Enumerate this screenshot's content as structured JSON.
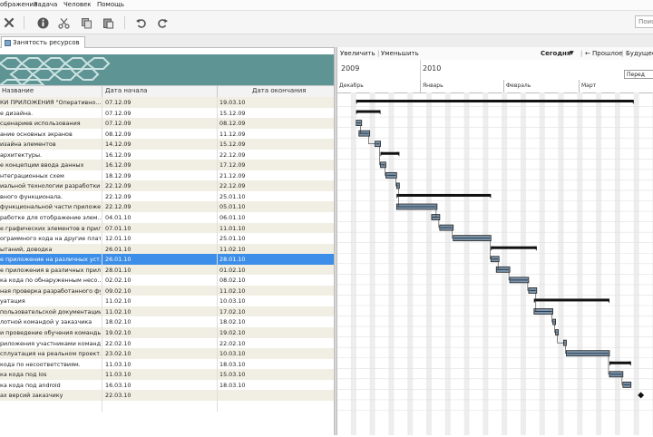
{
  "menu": [
    "ображение",
    "Задача",
    "Человек",
    "Помощь"
  ],
  "search": {
    "placeholder": "Поиск"
  },
  "tab": {
    "label": "Занятость ресурсов"
  },
  "columns": {
    "name": "Название",
    "start": "Дата начала",
    "end": "Дата окончания"
  },
  "rows": [
    {
      "name": "КИ ПРИЛОЖЕНИЯ \"Оперативно...",
      "start": "07.12.09",
      "end": "19.03.10",
      "kind": "summary"
    },
    {
      "name": "е дизайна.",
      "start": "07.12.09",
      "end": "15.12.09",
      "kind": "summary"
    },
    {
      "name": "сценариев использования",
      "start": "07.12.09",
      "end": "08.12.09",
      "kind": "task"
    },
    {
      "name": "ание основных экранов",
      "start": "08.12.09",
      "end": "11.12.09",
      "kind": "task"
    },
    {
      "name": "изайна элементов",
      "start": "14.12.09",
      "end": "15.12.09",
      "kind": "task"
    },
    {
      "name": "архитектуры.",
      "start": "16.12.09",
      "end": "22.12.09",
      "kind": "summary"
    },
    {
      "name": "е концепции ввода данных",
      "start": "16.12.09",
      "end": "17.12.09",
      "kind": "task"
    },
    {
      "name": "нтеграционных схем",
      "start": "18.12.09",
      "end": "21.12.09",
      "kind": "task"
    },
    {
      "name": "иальной технологии разработки",
      "start": "22.12.09",
      "end": "22.12.09",
      "kind": "task"
    },
    {
      "name": "вного функционала.",
      "start": "22.12.09",
      "end": "25.01.10",
      "kind": "summary"
    },
    {
      "name": "функциональной части приложе...",
      "start": "22.12.09",
      "end": "05.01.10",
      "kind": "task"
    },
    {
      "name": "работке для отображение элем...",
      "start": "04.01.10",
      "end": "06.01.10",
      "kind": "task"
    },
    {
      "name": "е графических элементов в прил...",
      "start": "07.01.10",
      "end": "11.01.10",
      "kind": "task"
    },
    {
      "name": "ограммного кода на другие плат...",
      "start": "12.01.10",
      "end": "25.01.10",
      "kind": "task"
    },
    {
      "name": "ытаний, доводка",
      "start": "26.01.10",
      "end": "11.02.10",
      "kind": "summary"
    },
    {
      "name": "е приложение на различных уст...",
      "start": "26.01.10",
      "end": "28.01.10",
      "kind": "task",
      "selected": true
    },
    {
      "name": "е приложения в различных  прил...",
      "start": "28.01.10",
      "end": "01.02.10",
      "kind": "task"
    },
    {
      "name": "ка кода по обнаруженным несо...",
      "start": "02.02.10",
      "end": "08.02.10",
      "kind": "task"
    },
    {
      "name": "ная проверка разработанного фу...",
      "start": "09.02.10",
      "end": "11.02.10",
      "kind": "task"
    },
    {
      "name": "уатация",
      "start": "11.02.10",
      "end": "10.03.10",
      "kind": "summary"
    },
    {
      "name": "пользовательской документации",
      "start": "11.02.10",
      "end": "17.02.10",
      "kind": "task"
    },
    {
      "name": "лотной командой у заказчика",
      "start": "18.02.10",
      "end": "18.02.10",
      "kind": "task"
    },
    {
      "name": "и проведение обучения команды",
      "start": "19.02.10",
      "end": "19.02.10",
      "kind": "task"
    },
    {
      "name": "риложения участниками команды",
      "start": "22.02.10",
      "end": "22.02.10",
      "kind": "task"
    },
    {
      "name": "сплуатация на реальном проект...",
      "start": "23.02.10",
      "end": "10.03.10",
      "kind": "task"
    },
    {
      "name": "кода по несоответствиям.",
      "start": "11.03.10",
      "end": "18.03.10",
      "kind": "summary"
    },
    {
      "name": "ка кода под ios",
      "start": "11.03.10",
      "end": "15.03.10",
      "kind": "task"
    },
    {
      "name": "ка кода под android",
      "start": "16.03.10",
      "end": "18.03.10",
      "kind": "task"
    },
    {
      "name": "ах версий заказчику",
      "start": "22.03.10",
      "end": "",
      "kind": "milestone"
    }
  ],
  "gantt": {
    "zoom_in": "Увеличить",
    "zoom_out": "Уменьшить",
    "today": "Сегодня",
    "past": "Прошлое",
    "future": "Будущее",
    "years": [
      "2009",
      "2010"
    ],
    "months": [
      "Декабрь",
      "Январь",
      "Февраль",
      "Март"
    ],
    "note": "Перед",
    "timeline_start": "2009-11-30"
  },
  "colors": {
    "accent": "#3d8ee8",
    "banner": "#5f9494",
    "bar": "#7d94a8",
    "summary": "#111111",
    "alt_row": "#f1efe3"
  }
}
